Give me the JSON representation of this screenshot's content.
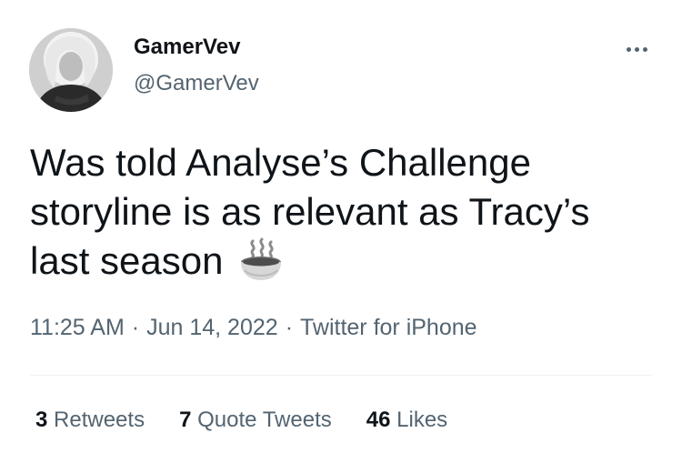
{
  "user": {
    "display_name": "GamerVev",
    "handle": "@GamerVev",
    "avatar_icon": "profile-photo"
  },
  "tweet": {
    "text": "Was told Analyse’s Challenge storyline is as relevant as Tracy’s last season",
    "emoji_icon": "hot-beverage-icon"
  },
  "meta": {
    "time": "11:25 AM",
    "separator": "·",
    "date": "Jun 14, 2022",
    "source": "Twitter for iPhone"
  },
  "stats": {
    "retweets_count": "3",
    "retweets_label": "Retweets",
    "quotes_count": "7",
    "quotes_label": "Quote Tweets",
    "likes_count": "46",
    "likes_label": "Likes"
  },
  "colors": {
    "text_primary": "#0f1419",
    "text_secondary": "#536471",
    "divider": "#eff3f4",
    "background": "#ffffff"
  }
}
